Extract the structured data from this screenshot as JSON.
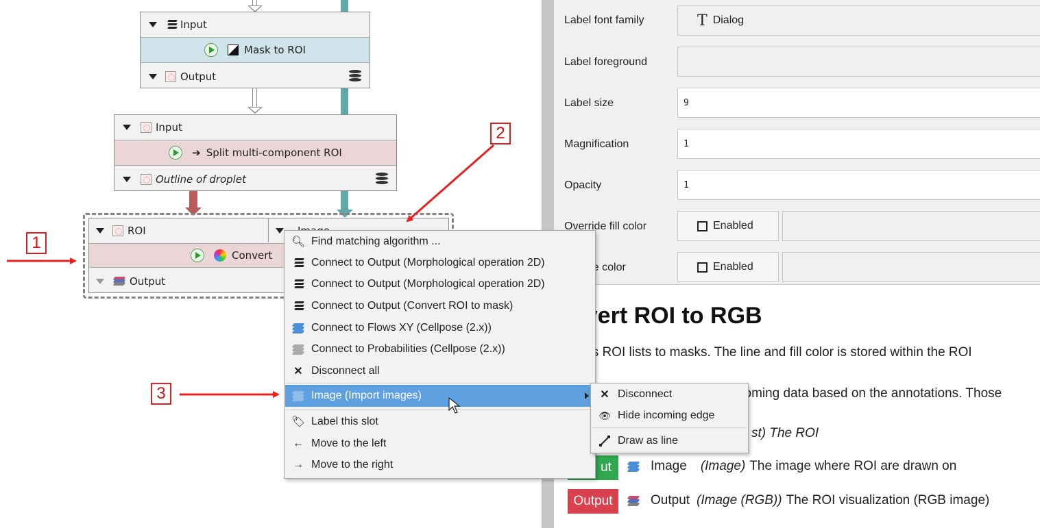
{
  "graph": {
    "node1": {
      "input_label": "Input",
      "algorithm": "Mask to ROI",
      "output_label": "Output"
    },
    "node2": {
      "input_label": "Input",
      "algorithm": "Split multi-component ROI",
      "output_label": "Outline of droplet"
    },
    "node3": {
      "input_roi_label": "ROI",
      "input_image_label": "Image",
      "algorithm": "Convert",
      "output_label": "Output"
    }
  },
  "callouts": [
    "1",
    "2",
    "3"
  ],
  "properties": {
    "rows": [
      {
        "label": "Label font family",
        "value": "Dialog",
        "icon": "font-icon"
      },
      {
        "label": "Label foreground",
        "value": ""
      },
      {
        "label": "Label size",
        "value": "9"
      },
      {
        "label": "Magnification",
        "value": "1"
      },
      {
        "label": "Opacity",
        "value": "1"
      },
      {
        "label": "Override fill color",
        "value": "Enabled"
      },
      {
        "label": "ide line color",
        "value": "Enabled"
      }
    ],
    "override_prefix": "Over"
  },
  "doc": {
    "title": "nvert ROI to RGB",
    "description": "verts ROI lists to masks. The line and fill color is stored within the ROI",
    "line2": "coming data based on the annotations. Those",
    "roi_line_suffix": "st) The ROI",
    "image_slot": {
      "badge": "ut",
      "name": "Image",
      "type": "(Image)",
      "desc": "The image where ROI are drawn on"
    },
    "output_slot": {
      "badge": "Output",
      "name": "Output",
      "type": "(Image (RGB))",
      "desc": "The ROI visualization (RGB image)"
    }
  },
  "context_menu": {
    "items": [
      {
        "label": "Find matching algorithm ...",
        "icon": "search-icon"
      },
      {
        "label": "Connect to Output (Morphological operation 2D)",
        "icon": "mask-icon"
      },
      {
        "label": "Connect to Output (Morphological operation 2D)",
        "icon": "mask-icon"
      },
      {
        "label": "Connect to Output (Convert ROI to mask)",
        "icon": "mask-icon"
      },
      {
        "label": "Connect to Flows XY (Cellpose (2.x))",
        "icon": "image-layers-icon"
      },
      {
        "label": "Connect to Probabilities (Cellpose (2.x))",
        "icon": "grey-layers-icon"
      },
      {
        "label": "Disconnect all",
        "icon": "close-icon"
      },
      {
        "label": "Image (Import images)",
        "icon": "image-layers-icon"
      },
      {
        "label": "Label this slot",
        "icon": "tag-icon"
      },
      {
        "label": "Move to the left",
        "icon": "arrow-left-icon"
      },
      {
        "label": "Move to the right",
        "icon": "arrow-right-icon"
      }
    ]
  },
  "submenu": {
    "items": [
      {
        "label": "Disconnect",
        "icon": "close-icon"
      },
      {
        "label": "Hide incoming edge",
        "icon": "eye-slash-icon"
      },
      {
        "label": "Draw as line",
        "icon": "line-icon"
      }
    ]
  },
  "colors": {
    "selection": "#5fa0e0",
    "algorithm_blue": "#cfe3ea",
    "algorithm_red": "#ead6d6",
    "callout_red": "#e02020",
    "input_badge": "#2fa84f",
    "output_badge": "#d9414e",
    "teal_edge": "#5fa9a9",
    "red_edge": "#b85c5c"
  }
}
